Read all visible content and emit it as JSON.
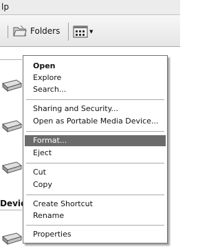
{
  "menubar": {
    "partial_label": "lp"
  },
  "toolbar": {
    "folders_label": "Folders",
    "folders_icon": "folders-icon",
    "views_icon": "views-icon"
  },
  "content": {
    "section_header_partial": "Devic"
  },
  "context_menu": {
    "highlight_color": "#6b6b6b",
    "items": [
      {
        "label": "Open",
        "bold": true
      },
      {
        "label": "Explore"
      },
      {
        "label": "Search..."
      },
      {
        "label": "Sharing and Security..."
      },
      {
        "label": "Open as Portable Media Device..."
      },
      {
        "label": "Format...",
        "highlighted": true
      },
      {
        "label": "Eject"
      },
      {
        "label": "Cut"
      },
      {
        "label": "Copy"
      },
      {
        "label": "Create Shortcut"
      },
      {
        "label": "Rename"
      },
      {
        "label": "Properties"
      }
    ]
  }
}
